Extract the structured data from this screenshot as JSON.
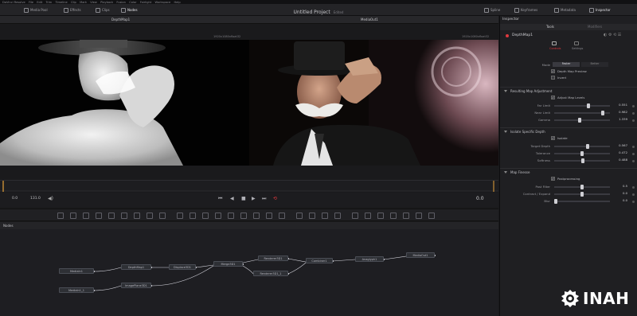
{
  "menubar": {
    "items": [
      "DaVinci Resolve",
      "File",
      "Edit",
      "Trim",
      "Timeline",
      "Clip",
      "Mark",
      "View",
      "Playback",
      "Fusion",
      "Color",
      "Fairlight",
      "Workspace",
      "Help"
    ]
  },
  "toolbar": {
    "media_pool": "Media Pool",
    "effects": "Effects",
    "clips": "Clips",
    "nodes": "Nodes",
    "project_title": "Untitled Project",
    "edited": "Edited",
    "spline": "Spline",
    "keyframes": "Keyframes",
    "metadata": "Metadata",
    "inspector": "Inspector"
  },
  "viewers": {
    "left_name": "DepthMap1",
    "right_name": "MediaOut1",
    "left_res": "1920x1080xfloat32",
    "right_res": "1920x1080xfloat32"
  },
  "transport": {
    "start": "0.0",
    "end": "131.0",
    "current": "0.0"
  },
  "nodes_panel": {
    "title": "Nodes",
    "nodes": [
      {
        "id": "mediain1",
        "label": "MediaIn1"
      },
      {
        "id": "mediain1_1",
        "label": "MediaIn1_1"
      },
      {
        "id": "depthmap1",
        "label": "DepthMap1"
      },
      {
        "id": "imageplane3d1",
        "label": "ImagePlane3D1"
      },
      {
        "id": "displace3d1",
        "label": "Displace3D1"
      },
      {
        "id": "merge3d1",
        "label": "Merge3D1"
      },
      {
        "id": "renderer3d1",
        "label": "Renderer3D1"
      },
      {
        "id": "renderer3d1_1",
        "label": "Renderer3D1_1"
      },
      {
        "id": "combiner1",
        "label": "Combiner1"
      },
      {
        "id": "anaglyph1",
        "label": "Anaglyph1"
      },
      {
        "id": "mediaout1",
        "label": "MediaOut1"
      }
    ]
  },
  "inspector": {
    "title": "Inspector",
    "tab_tools": "Tools",
    "tab_modifiers": "Modifiers",
    "node_name": "DepthMap1",
    "subtab_controls": "Controls",
    "subtab_settings": "Settings",
    "mode_label": "Mode",
    "mode_faster": "Faster",
    "mode_better": "Better",
    "depth_map_preview": "Depth Map Preview",
    "invert": "Invert",
    "section1": "Resulting Map Adjustment",
    "adjust_map_levels": "Adjust Map Levels",
    "far_limit_label": "Far Limit",
    "far_limit_value": "0.551",
    "far_limit_level": 0.62,
    "near_limit_label": "Near Limit",
    "near_limit_value": "0.982",
    "near_limit_level": 0.9,
    "gamma_label": "Gamma",
    "gamma_value": "1.339",
    "gamma_level": 0.45,
    "section2": "Isolate Specific Depth",
    "isolate": "Isolate",
    "target_depth_label": "Target Depth",
    "target_depth_value": "0.567",
    "target_depth_level": 0.6,
    "tolerance_label": "Tolerance",
    "tolerance_value": "0.472",
    "tolerance_level": 0.5,
    "softness_label": "Softness",
    "softness_value": "0.488",
    "softness_level": 0.52,
    "section3": "Map Finesse",
    "postprocessing": "Postprocessing",
    "post_filter_label": "Post Filter",
    "post_filter_value": "0.5",
    "post_filter_level": 0.5,
    "contract_expand_label": "Contract / Expand",
    "contract_expand_value": "0.0",
    "contract_expand_level": 0.5,
    "blur_label": "Blur",
    "blur_value": "0.0",
    "blur_level": 0.0
  },
  "watermark": {
    "text": "INAH"
  },
  "colors": {
    "accent_red": "#e0393e",
    "playhead_orange": "#e8a23a",
    "node_link": "#d8d8e0"
  }
}
